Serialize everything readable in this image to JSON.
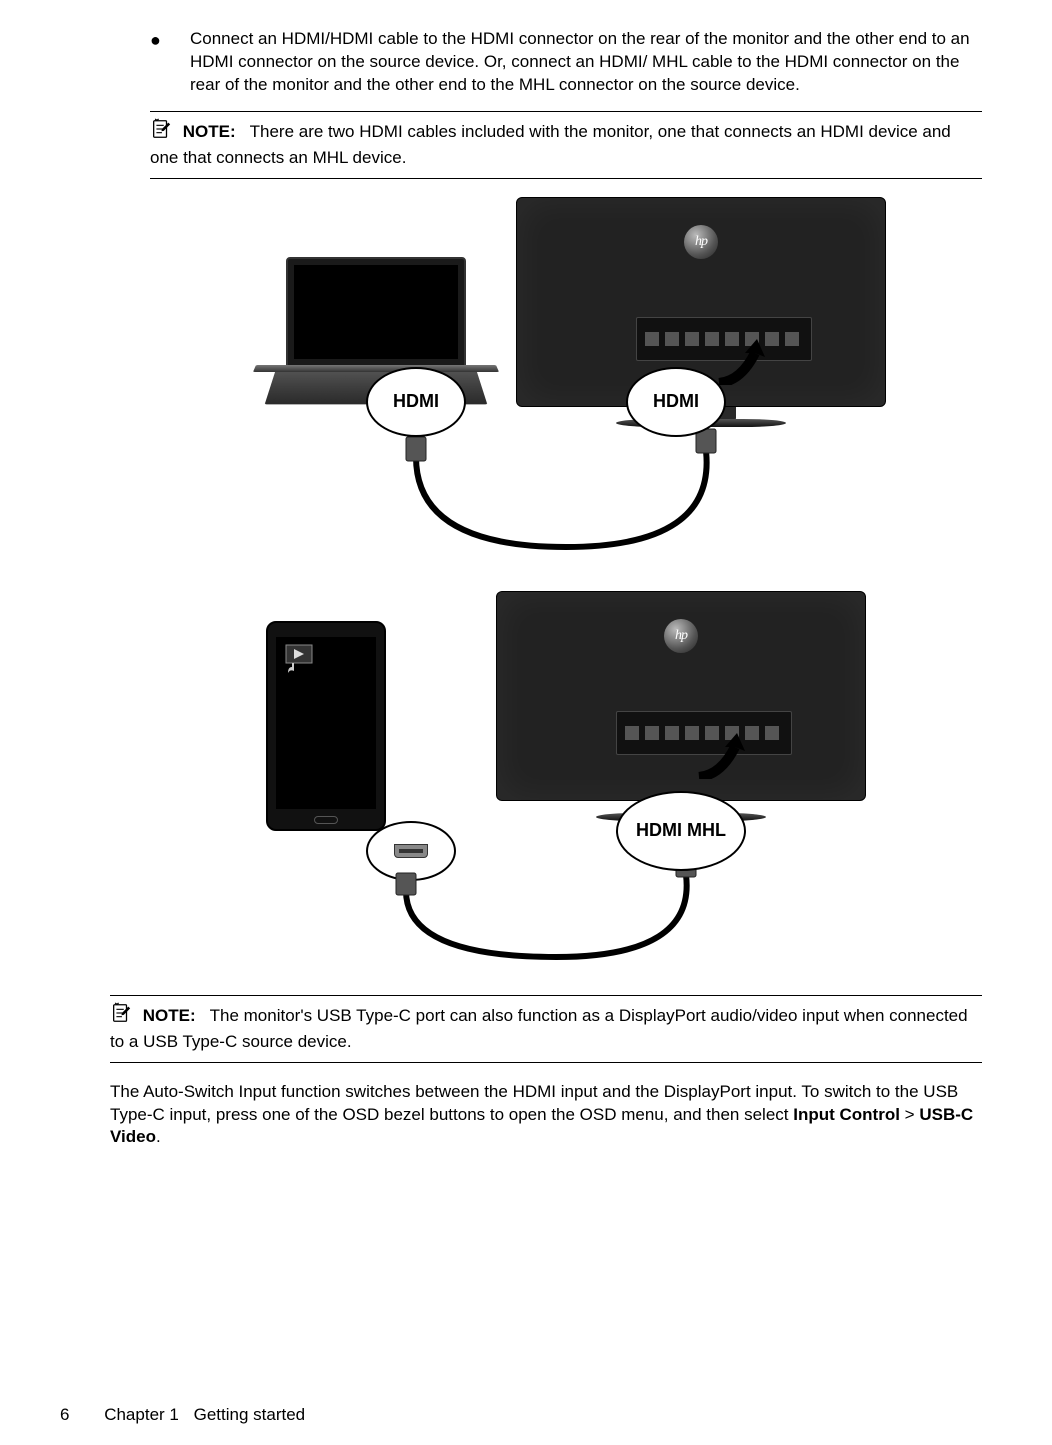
{
  "bullet_text": "Connect an HDMI/HDMI cable to the HDMI connector on the rear of the monitor and the other end to an HDMI connector on the source device. Or, connect an HDMI/ MHL cable to the HDMI connector on the rear of the monitor and the other end to the MHL connector on the source device.",
  "note1": {
    "label": "NOTE:",
    "text": "There are two HDMI cables included with the monitor, one that connects an HDMI device and one that connects an MHL device."
  },
  "figure1": {
    "callout_left": "HDMI",
    "callout_right": "HDMI",
    "logo": "hp"
  },
  "figure2": {
    "callout_right": "HDMI MHL",
    "logo": "hp"
  },
  "note2": {
    "label": "NOTE:",
    "text": "The monitor's USB Type-C port can also function as a DisplayPort audio/video input when connected to a USB Type-C source device."
  },
  "paragraph_parts": {
    "p1": "The Auto-Switch Input function switches between the HDMI input and the DisplayPort input. To switch to the USB Type-C input, press one of the OSD bezel buttons to open the OSD menu, and then select ",
    "b1": "Input Control",
    "sep": " > ",
    "b2": "USB-C Video",
    "end": "."
  },
  "footer": {
    "page_number": "6",
    "chapter_label": "Chapter 1",
    "chapter_title": "Getting started"
  }
}
